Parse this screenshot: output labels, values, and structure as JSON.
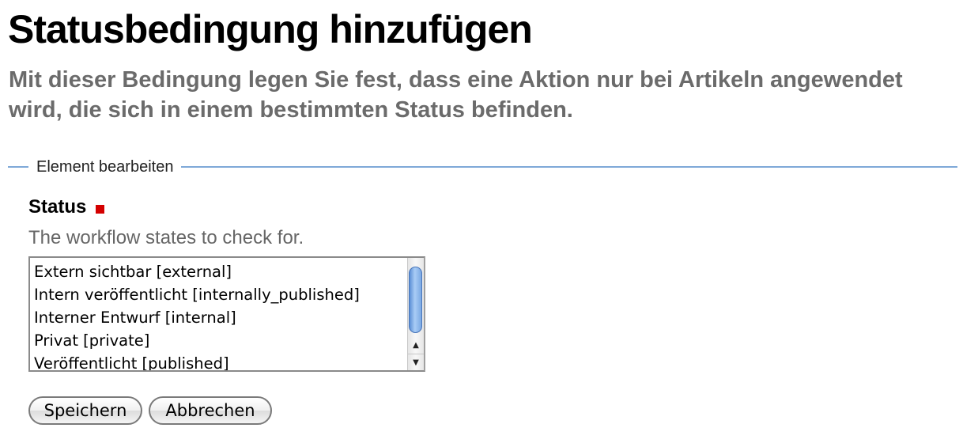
{
  "page": {
    "title": "Statusbedingung hinzufügen",
    "description": "Mit dieser Bedingung legen Sie fest, dass eine Aktion nur bei Artikeln angewendet wird, die sich in einem bestimmten Status befinden."
  },
  "form": {
    "legend": "Element bearbeiten",
    "status_field": {
      "label": "Status",
      "required": true,
      "help": "The workflow states to check for.",
      "options": [
        "Extern sichtbar [external]",
        "Intern veröffentlicht [internally_published]",
        "Interner Entwurf [internal]",
        "Privat [private]",
        "Veröffentlicht [published]"
      ]
    },
    "buttons": {
      "save_label": "Speichern",
      "cancel_label": "Abbrechen"
    }
  },
  "colors": {
    "required_marker": "#d40000",
    "fieldset_border": "#7fa9d8",
    "description_text": "#6b6b6b"
  },
  "icons": {
    "scroll_up": "triangle-up-icon",
    "scroll_down": "triangle-down-icon",
    "required": "required-square-icon"
  }
}
